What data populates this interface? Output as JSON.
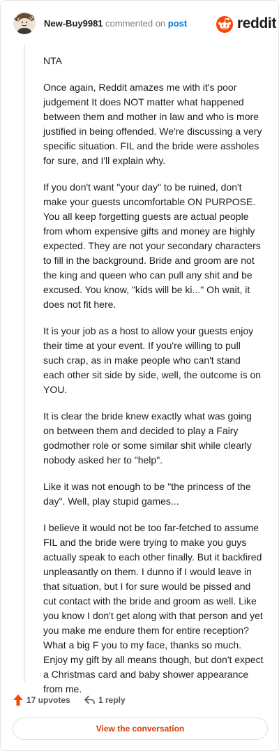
{
  "header": {
    "username": "New-Buy9981",
    "action_text": "commented on",
    "post_link": "post",
    "brand": "reddit"
  },
  "comment": {
    "paragraphs": [
      "NTA",
      "Once again, Reddit amazes me with it's poor judgement It does NOT matter what happened between them and mother in law and who is more justified in being offended. We're discussing a very specific situation. FIL and the bride were assholes for sure, and I'll explain why.",
      "If you don't want \"your day\" to be ruined, don't make your guests uncomfortable ON PURPOSE. You all keep forgetting guests are actual people from whom expensive gifts and money are highly expected. They are not your secondary characters to fill in the background. Bride and groom are not the king and queen who can pull any shit and be excused. You know, \"kids will be ki...\" Oh wait, it does not fit here.",
      "It is your job as a host to allow your guests enjoy their time at your event. If you're willing to pull such crap, as in make people who can't stand each other sit side by side, well, the outcome is on YOU.",
      "It is clear the bride knew exactly what was going on between them and decided to play a Fairy godmother role or some similar shit while clearly nobody asked her to \"help\".",
      "Like it was not enough to be \"the princess of the day\". Well, play stupid games...",
      "I believe it would not be too far-fetched to assume FIL and the bride were trying to make you guys actually speak to each other finally. But it backfired unpleasantly on them. I dunno if I would leave in that situation, but I for sure would be pissed and cut contact with the bride and groom as well. Like you know I don't get along with that person and yet you make me endure them for entire reception? What a big F you to my face, thanks so much. Enjoy my gift by all means though, but don't expect a Christmas card and baby shower appearance from me."
    ]
  },
  "actions": {
    "upvotes": "17 upvotes",
    "replies": "1 reply"
  },
  "footer": {
    "view_button": "View the conversation"
  },
  "colors": {
    "reddit_orange": "#ff4500",
    "link_blue": "#0079d3",
    "button_text": "#d93a00"
  },
  "icons": {
    "avatar": "user-avatar",
    "brand": "reddit-logo-icon",
    "upvote": "upvote-arrow-icon",
    "reply": "reply-arrow-icon"
  }
}
